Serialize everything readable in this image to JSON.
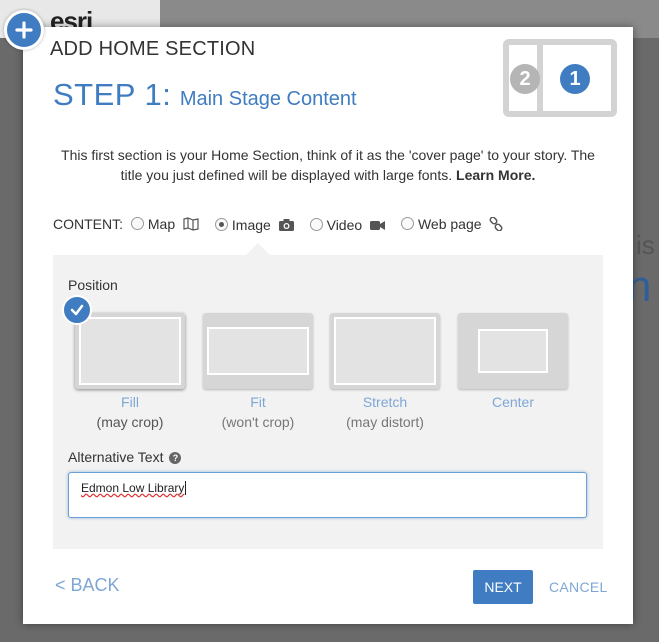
{
  "background": {
    "logo_text": "esri",
    "snippet_is": "is",
    "snippet_n": "n"
  },
  "modal": {
    "title": "ADD HOME SECTION",
    "step_label": "STEP 1:",
    "step_subtitle": "Main Stage Content",
    "plus_icon": "plus-icon",
    "layout_thumbnail": {
      "left_number": "2",
      "right_number": "1"
    },
    "intro_text": "This first section is your Home Section, think of it as the 'cover page' to your story. The title you just defined will be displayed with large fonts.",
    "learn_more": "Learn More."
  },
  "content_selector": {
    "label": "CONTENT:",
    "options": [
      {
        "label": "Map",
        "icon": "map-icon",
        "checked": false
      },
      {
        "label": "Image",
        "icon": "camera-icon",
        "checked": true
      },
      {
        "label": "Video",
        "icon": "video-camera-icon",
        "checked": false
      },
      {
        "label": "Web page",
        "icon": "link-icon",
        "checked": false
      }
    ]
  },
  "position": {
    "label": "Position",
    "selected": "Fill",
    "options": [
      {
        "name": "Fill",
        "hint": "(may crop)"
      },
      {
        "name": "Fit",
        "hint": "(won't crop)"
      },
      {
        "name": "Stretch",
        "hint": "(may distort)"
      },
      {
        "name": "Center",
        "hint": ""
      }
    ]
  },
  "alt_text": {
    "label": "Alternative Text",
    "value": "Edmon Low Library"
  },
  "footer": {
    "back_label": "< BACK",
    "next_label": "NEXT",
    "cancel_label": "CANCEL"
  },
  "colors": {
    "accent": "#3f7cc1",
    "link": "#7ea7d6",
    "panel": "#f2f2f2"
  }
}
